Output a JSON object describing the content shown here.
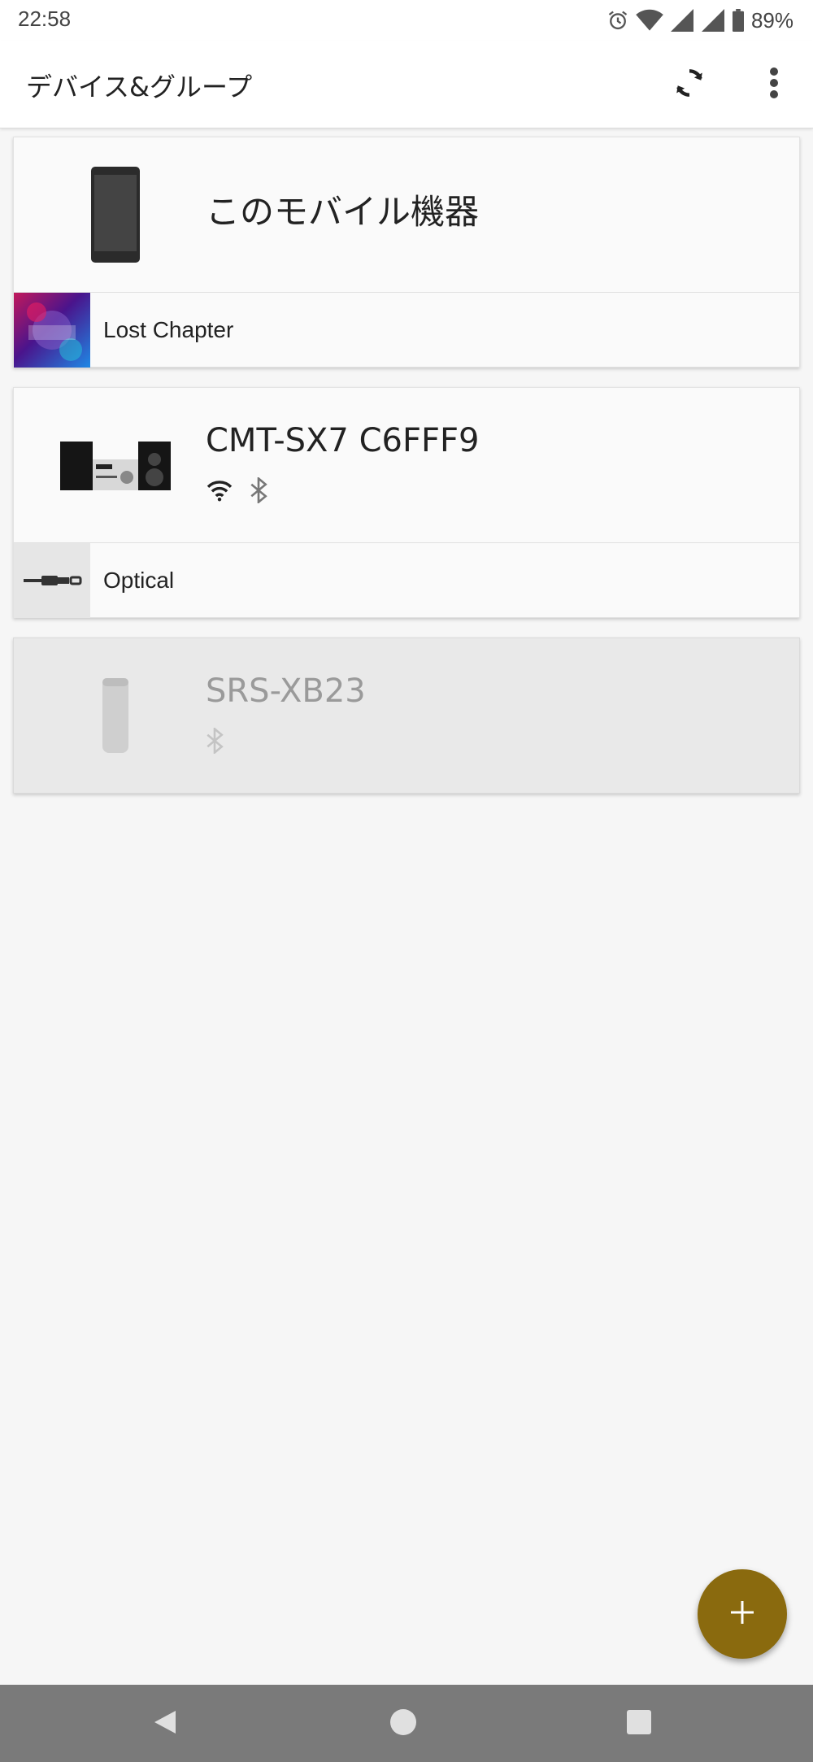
{
  "status_bar": {
    "time": "22:58",
    "battery_percent": "89%",
    "icons": [
      "alarm-icon",
      "wifi-icon",
      "signal-icon",
      "signal-icon",
      "battery-icon"
    ]
  },
  "app_bar": {
    "title": "デバイス&グループ",
    "actions": [
      "refresh-icon",
      "more-vert-icon"
    ]
  },
  "devices": [
    {
      "name": "このモバイル機器",
      "image": "smartphone",
      "connections": [],
      "source": {
        "label": "Lost Chapter",
        "thumb": "album-art"
      },
      "enabled": true
    },
    {
      "name": "CMT-SX7 C6FFF9",
      "image": "micro-hifi-system",
      "connections": [
        "wifi-icon",
        "bluetooth-icon"
      ],
      "source": {
        "label": "Optical",
        "thumb": "optical-cable-icon"
      },
      "enabled": true
    },
    {
      "name": "SRS-XB23",
      "image": "portable-speaker",
      "connections": [
        "bluetooth-icon"
      ],
      "enabled": false
    }
  ],
  "fab": {
    "icon": "plus-icon",
    "color": "#8a6a0e"
  },
  "nav_bar": {
    "buttons": [
      "back-icon",
      "home-icon",
      "recents-icon"
    ]
  },
  "colors": {
    "background": "#f6f6f6",
    "card": "#fafafa",
    "card_disabled": "#e9e9e9",
    "accent": "#8a6a0e"
  }
}
